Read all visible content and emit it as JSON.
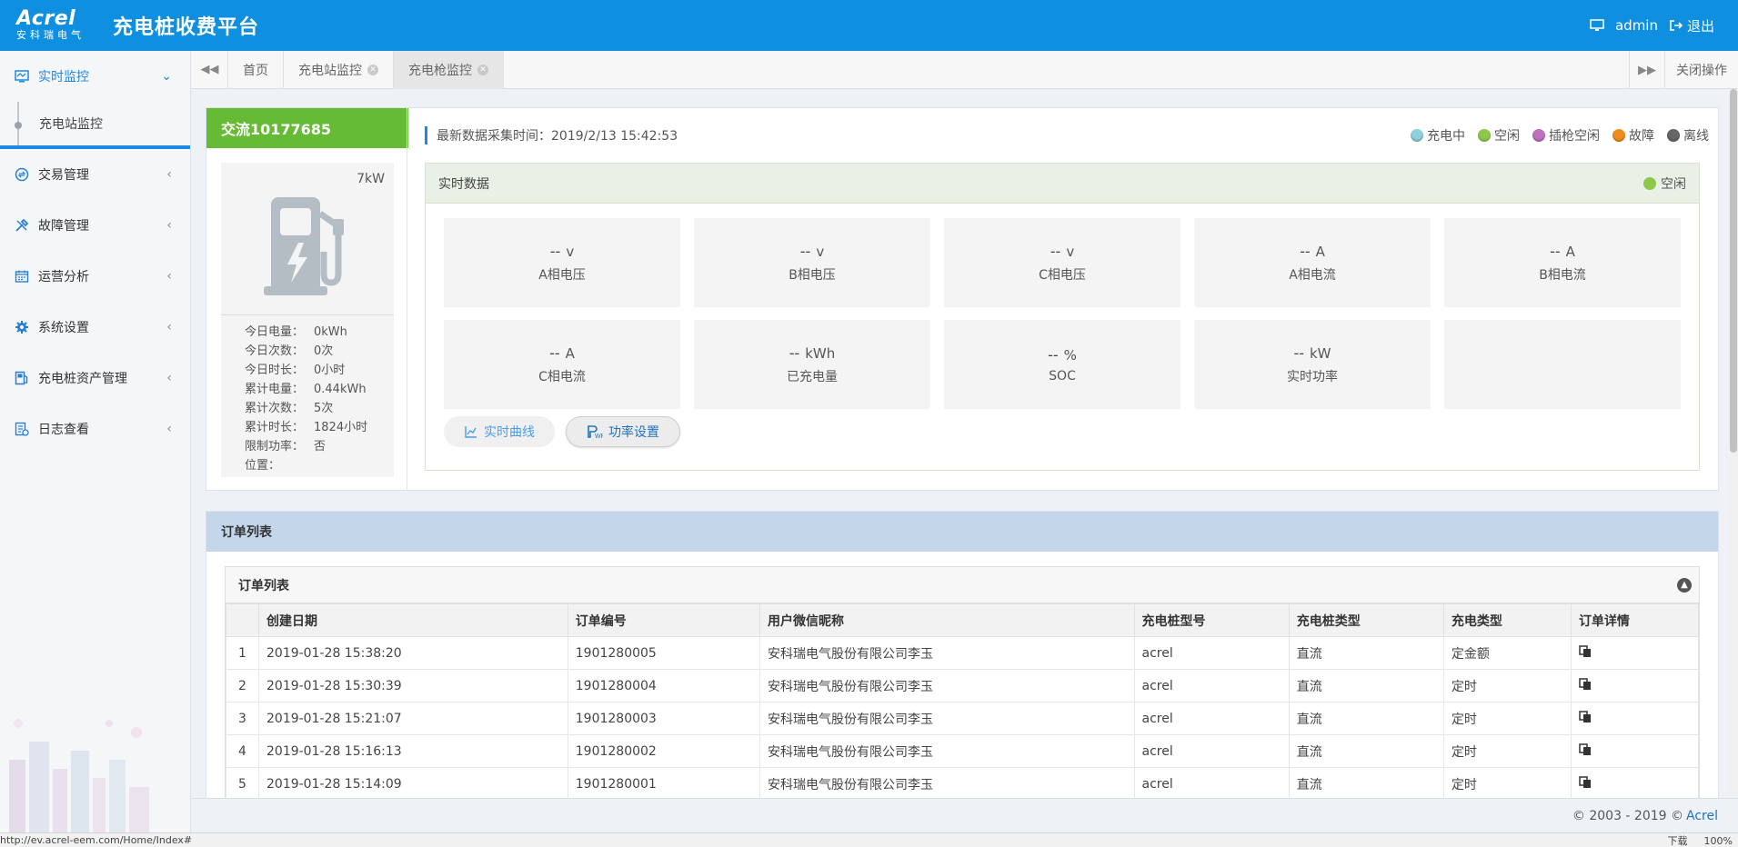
{
  "header": {
    "logo_word": "Acrel",
    "logo_sub": "安科瑞电气",
    "title": "充电桩收费平台",
    "user": "admin",
    "logout": "退出"
  },
  "sidebar": {
    "items": [
      {
        "label": "实时监控",
        "icon": "monitor-icon",
        "active": true
      },
      {
        "label": "交易管理",
        "icon": "exchange-icon"
      },
      {
        "label": "故障管理",
        "icon": "tools-icon"
      },
      {
        "label": "运营分析",
        "icon": "calendar-icon"
      },
      {
        "label": "系统设置",
        "icon": "gear-icon"
      },
      {
        "label": "充电桩资产管理",
        "icon": "charger-icon"
      },
      {
        "label": "日志查看",
        "icon": "log-icon"
      }
    ],
    "sub_item": "充电站监控"
  },
  "tabs": {
    "items": [
      "首页",
      "充电站监控",
      "充电枪监控"
    ],
    "close_ops": "关闭操作"
  },
  "pile": {
    "name": "交流10177685",
    "power": "7kW",
    "stats": [
      {
        "k": "今日电量：",
        "v": "0kWh"
      },
      {
        "k": "今日次数：",
        "v": "0次"
      },
      {
        "k": "今日时长：",
        "v": "0小时"
      },
      {
        "k": "累计电量：",
        "v": "0.44kWh"
      },
      {
        "k": "累计次数：",
        "v": "5次"
      },
      {
        "k": "累计时长：",
        "v": "1824小时"
      },
      {
        "k": "限制功率：",
        "v": "否"
      },
      {
        "k": "位置：",
        "v": ""
      }
    ],
    "status_color": "#66bb34"
  },
  "collect_time": "最新数据采集时间：2019/2/13 15:42:53",
  "legend": [
    {
      "label": "充电中",
      "color": "#8fd0dc"
    },
    {
      "label": "空闲",
      "color": "#8cc94a"
    },
    {
      "label": "插枪空闲",
      "color": "#c070c0"
    },
    {
      "label": "故障",
      "color": "#f08c1c"
    },
    {
      "label": "离线",
      "color": "#666666"
    }
  ],
  "realtime": {
    "title": "实时数据",
    "status": "空闲",
    "cells": [
      {
        "value": "--",
        "unit": "v",
        "label": "A相电压"
      },
      {
        "value": "--",
        "unit": "v",
        "label": "B相电压"
      },
      {
        "value": "--",
        "unit": "v",
        "label": "C相电压"
      },
      {
        "value": "--",
        "unit": "A",
        "label": "A相电流"
      },
      {
        "value": "--",
        "unit": "A",
        "label": "B相电流"
      },
      {
        "value": "--",
        "unit": "A",
        "label": "C相电流"
      },
      {
        "value": "--",
        "unit": "kWh",
        "label": "已充电量"
      },
      {
        "value": "--",
        "unit": "%",
        "label": "SOC"
      },
      {
        "value": "--",
        "unit": "kW",
        "label": "实时功率"
      },
      {
        "value": "",
        "unit": "",
        "label": ""
      }
    ],
    "btn_curve": "实时曲线",
    "btn_power": "功率设置"
  },
  "orders": {
    "section_title": "订单列表",
    "inner_title": "订单列表",
    "columns": [
      "创建日期",
      "订单编号",
      "用户微信昵称",
      "充电桩型号",
      "充电桩类型",
      "充电类型",
      "订单详情"
    ],
    "rows": [
      {
        "n": "1",
        "date": "2019-01-28 15:38:20",
        "no": "1901280005",
        "user": "安科瑞电气股份有限公司李玉",
        "model": "acrel",
        "ptype": "直流",
        "ctype": "定金额"
      },
      {
        "n": "2",
        "date": "2019-01-28 15:30:39",
        "no": "1901280004",
        "user": "安科瑞电气股份有限公司李玉",
        "model": "acrel",
        "ptype": "直流",
        "ctype": "定时"
      },
      {
        "n": "3",
        "date": "2019-01-28 15:21:07",
        "no": "1901280003",
        "user": "安科瑞电气股份有限公司李玉",
        "model": "acrel",
        "ptype": "直流",
        "ctype": "定时"
      },
      {
        "n": "4",
        "date": "2019-01-28 15:16:13",
        "no": "1901280002",
        "user": "安科瑞电气股份有限公司李玉",
        "model": "acrel",
        "ptype": "直流",
        "ctype": "定时"
      },
      {
        "n": "5",
        "date": "2019-01-28 15:14:09",
        "no": "1901280001",
        "user": "安科瑞电气股份有限公司李玉",
        "model": "acrel",
        "ptype": "直流",
        "ctype": "定时"
      }
    ]
  },
  "footer": {
    "copyright": "© 2003 - 2019 ©",
    "brand": "Acrel"
  },
  "statusbar": {
    "url": "http://ev.acrel-eem.com/Home/Index#",
    "download": "下载",
    "zoom": "100%"
  }
}
